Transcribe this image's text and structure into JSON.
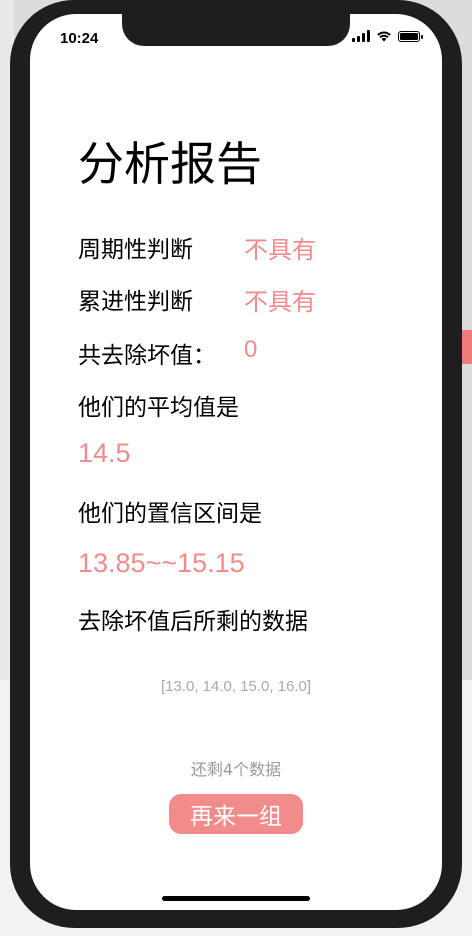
{
  "status_bar": {
    "time": "10:24"
  },
  "report": {
    "title": "分析报告",
    "periodicity_label": "周期性判断",
    "periodicity_value": "不具有",
    "progressive_label": "累进性判断",
    "progressive_value": "不具有",
    "removed_label": "共去除坏值：",
    "removed_value": "0",
    "mean_label": "他们的平均值是",
    "mean_value": "14.5",
    "ci_label": "他们的置信区间是",
    "ci_value": "13.85~~15.15",
    "remaining_label": "去除坏值后所剩的数据",
    "remaining_data": "[13.0, 14.0, 15.0, 16.0]",
    "remaining_count": "还剩4个数据",
    "again_button": "再来一组"
  },
  "colors": {
    "accent": "#f28b8b",
    "text": "#000000",
    "muted": "#a9a9a9",
    "phone_frame": "#1e1e1e"
  },
  "icons": [
    "signal-icon",
    "wifi-icon",
    "battery-icon"
  ]
}
